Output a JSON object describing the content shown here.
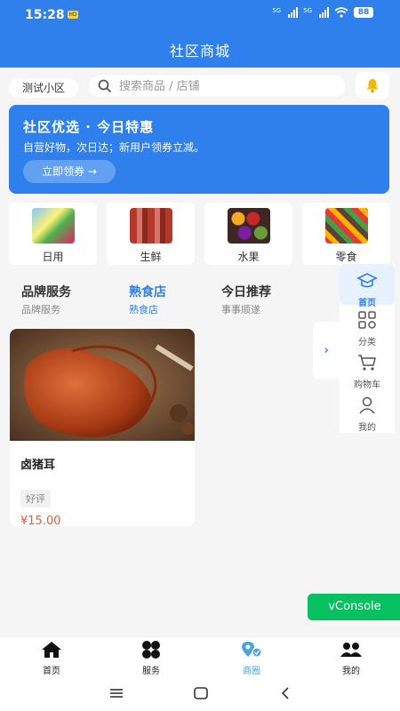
{
  "status_bar": {
    "time": "15:28",
    "hd_badge": "HD",
    "network_label": "5G",
    "battery": "88"
  },
  "header": {
    "title": "社区商城"
  },
  "search_row": {
    "community": "测试小区",
    "search_placeholder": "搜索商品 / 店铺",
    "bell_icon": "bell-icon"
  },
  "banner": {
    "title": "社区优选 · 今日特惠",
    "subtitle": "自营好物，次日达；新用户领券立减。",
    "button": "立即领券 →"
  },
  "categories": [
    {
      "label": "日用",
      "icon": "daily-goods-image"
    },
    {
      "label": "生鲜",
      "icon": "fresh-meat-image"
    },
    {
      "label": "水果",
      "icon": "fruit-image"
    },
    {
      "label": "零食",
      "icon": "snack-image"
    }
  ],
  "tabs": [
    {
      "title": "品牌服务",
      "subtitle": "品牌服务",
      "active": false
    },
    {
      "title": "熟食店",
      "subtitle": "熟食店",
      "active": true
    },
    {
      "title": "今日推荐",
      "subtitle": "事事顺遂",
      "active": false
    }
  ],
  "product": {
    "name": "卤猪耳",
    "tag": "好评",
    "price": "¥15.00"
  },
  "side_nav": {
    "arrow": "›",
    "items": [
      {
        "label": "首页",
        "icon": "home-hat-icon"
      },
      {
        "label": "分类",
        "icon": "grid-icon"
      },
      {
        "label": "购物车",
        "icon": "cart-icon"
      },
      {
        "label": "我的",
        "icon": "user-icon"
      }
    ]
  },
  "vconsole": {
    "label": "vConsole"
  },
  "tab_bar": [
    {
      "label": "首页",
      "icon": "home-icon"
    },
    {
      "label": "服务",
      "icon": "clover-icon"
    },
    {
      "label": "商圈",
      "icon": "map-pin-icon"
    },
    {
      "label": "我的",
      "icon": "users-icon"
    }
  ],
  "colors": {
    "primary": "#2f80ed",
    "price": "#e05c3a",
    "vconsole": "#07c160",
    "tab_active": "#4aa3d9"
  }
}
